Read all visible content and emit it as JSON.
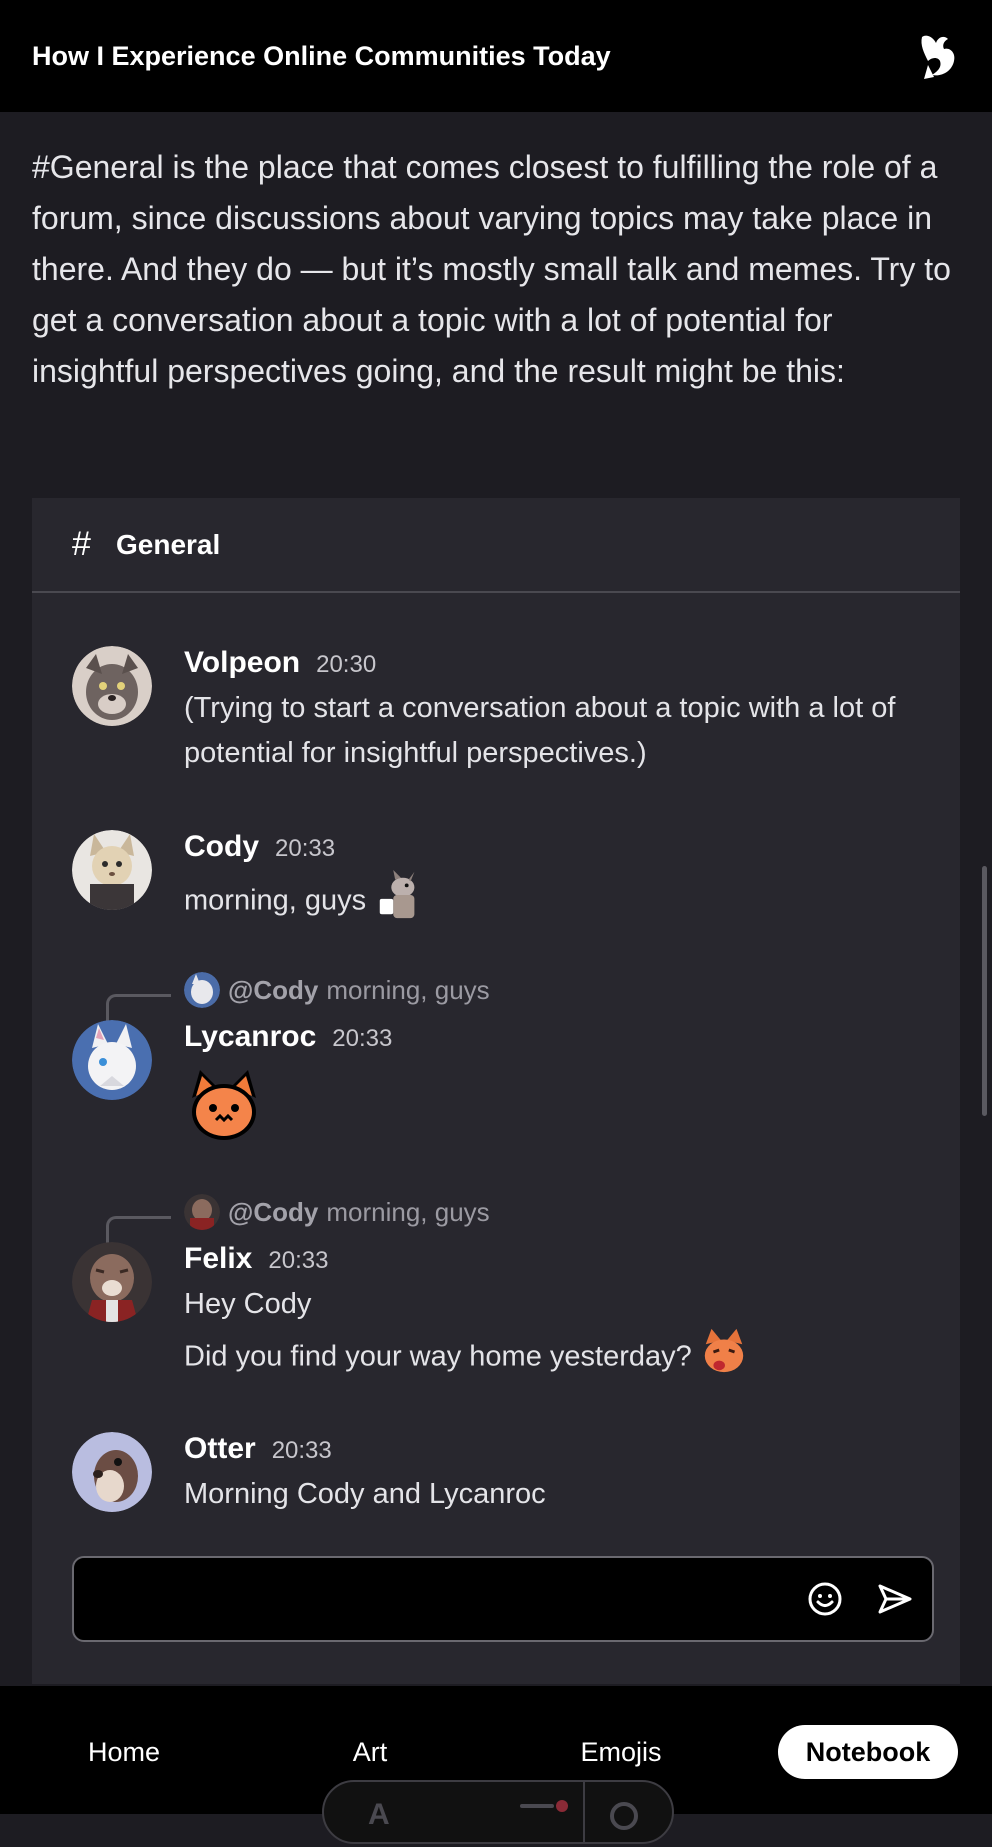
{
  "header": {
    "title": "How I Experience Online Communities Today"
  },
  "article": {
    "paragraph": "#General is the place that comes closest to fulfilling the role of a forum, since discussions about varying topics may take place in there. And they do — but it’s mostly small talk and memes. Try to get a conversation about a topic with a lot of potential for insightful perspectives going, and the result might be this:"
  },
  "chat": {
    "channel_symbol": "#",
    "channel_name": "General",
    "messages": [
      {
        "author": "Volpeon",
        "time": "20:30",
        "lines": [
          "(Trying to start a conversation about a topic with a lot of potential for insightful perspectives.)"
        ],
        "avatar": "volpeon-avatar"
      },
      {
        "author": "Cody",
        "time": "20:33",
        "lines": [
          "morning, guys"
        ],
        "avatar": "cody-avatar",
        "emoji": "coffee-dragon-emoji"
      },
      {
        "author": "Lycanroc",
        "time": "20:33",
        "reply_mention": "@Cody",
        "reply_text": "morning, guys",
        "lines": [],
        "avatar": "lycanroc-avatar",
        "emoji": "fox-face-emoji"
      },
      {
        "author": "Felix",
        "time": "20:33",
        "reply_mention": "@Cody",
        "reply_text": "morning, guys",
        "lines": [
          "Hey Cody",
          "Did you find your way home yesterday?"
        ],
        "avatar": "felix-avatar",
        "emoji": "fox-tongue-emoji"
      },
      {
        "author": "Otter",
        "time": "20:33",
        "lines": [
          "Morning Cody and Lycanroc"
        ],
        "avatar": "otter-avatar"
      }
    ],
    "composer": {
      "placeholder": ""
    }
  },
  "nav": {
    "items": [
      {
        "label": "Home",
        "active": false
      },
      {
        "label": "Art",
        "active": false
      },
      {
        "label": "Emojis",
        "active": false
      },
      {
        "label": "Notebook",
        "active": true
      }
    ]
  }
}
